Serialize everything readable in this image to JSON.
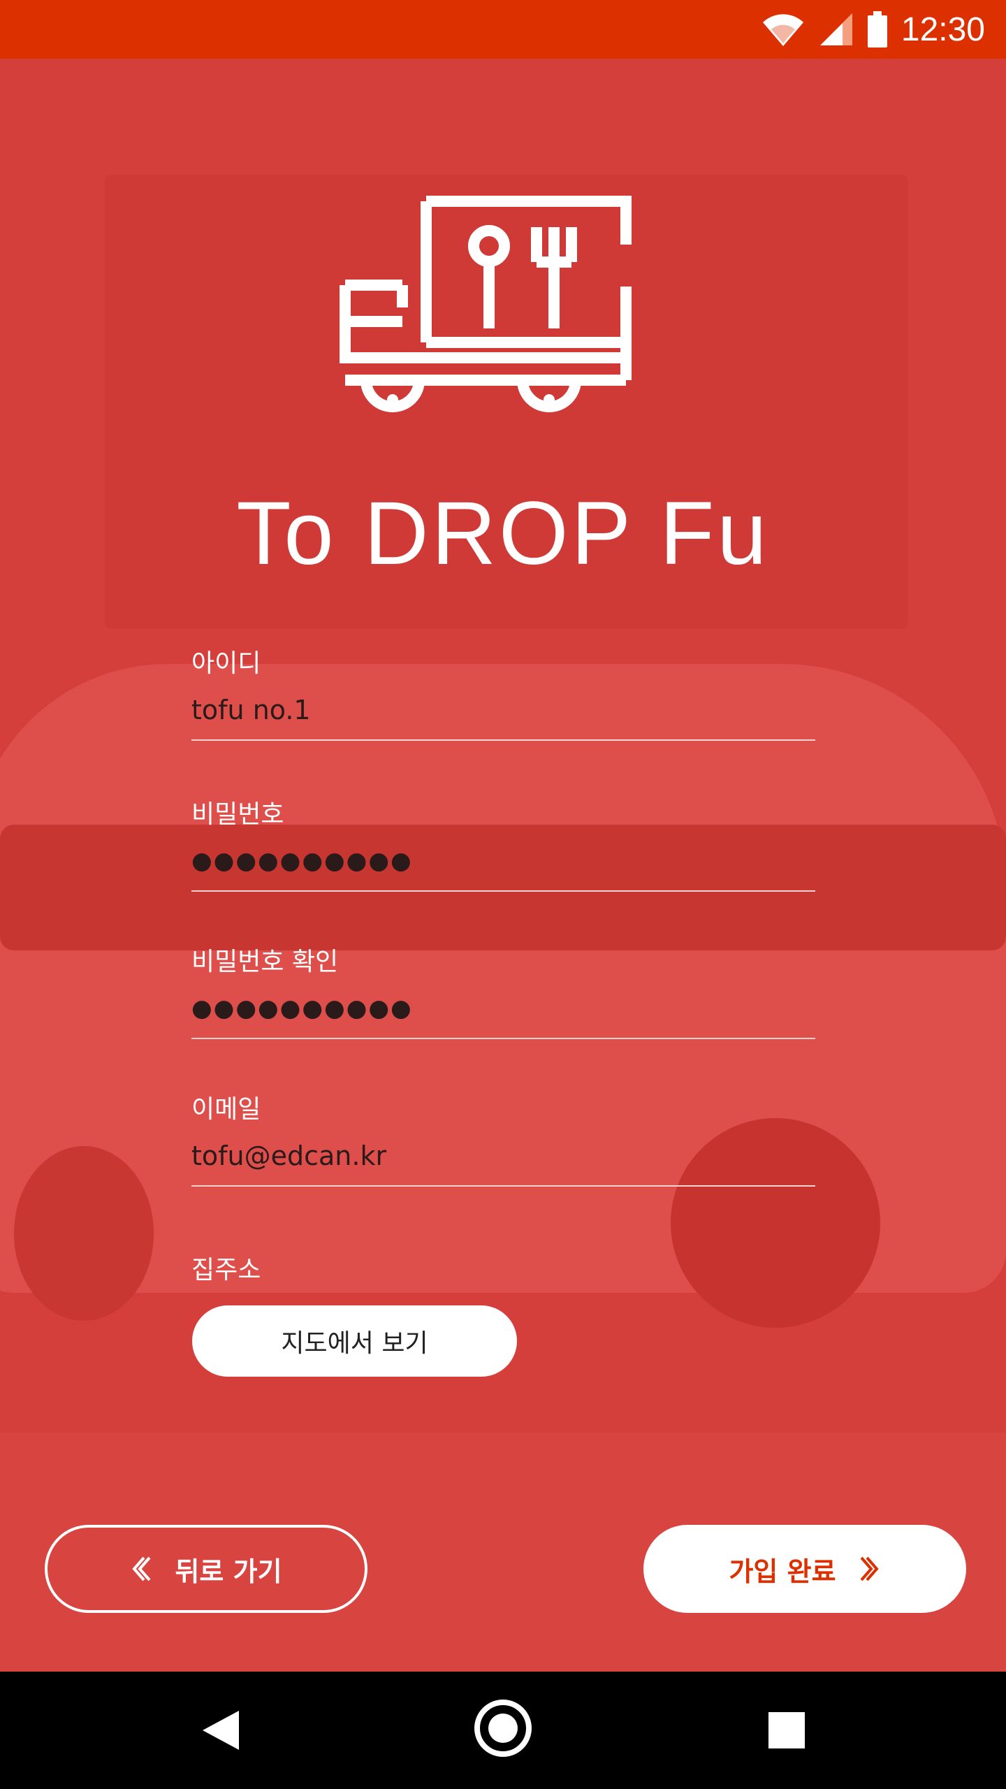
{
  "status_bar": {
    "time": "12:30",
    "icons": [
      "wifi-icon",
      "cell-signal-icon",
      "battery-icon"
    ]
  },
  "app": {
    "title": "To DROP Fu",
    "logo": "food-truck-logo-icon",
    "background_color": "#d53f3b",
    "accent_color": "#dd3000"
  },
  "form": {
    "id": {
      "label": "아이디",
      "value": "tofu no.1"
    },
    "password": {
      "label": "비밀번호",
      "value": "●●●●●●●●●●"
    },
    "password_confirm": {
      "label": "비밀번호 확인",
      "value": "●●●●●●●●●●"
    },
    "email": {
      "label": "이메일",
      "value": "tofu@edcan.kr"
    },
    "address": {
      "label": "집주소",
      "map_button": "지도에서 보기"
    }
  },
  "actions": {
    "back_label": "뒤로 가기",
    "complete_label": "가입 완료"
  },
  "nav_bar": {
    "icons": [
      "back-triangle-icon",
      "home-circle-icon",
      "recents-square-icon"
    ]
  }
}
